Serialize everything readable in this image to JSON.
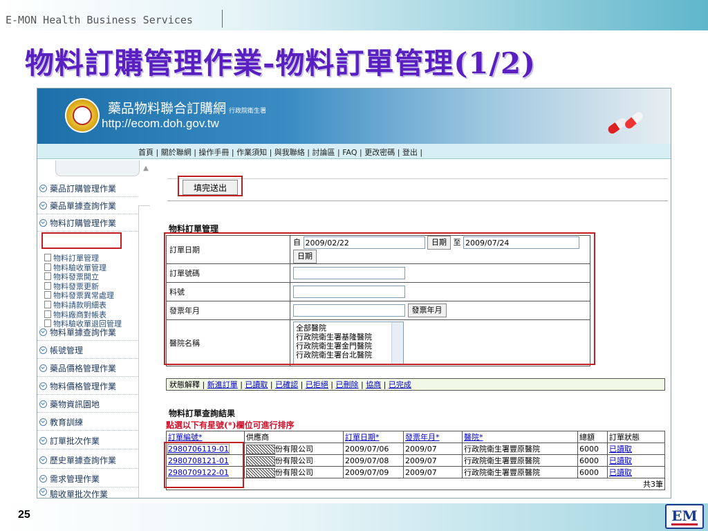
{
  "brand": "E-MON Health Business Services",
  "slide_title": "物料訂購管理作業-物料訂單管理(1/2)",
  "page_number": "25",
  "logo_text": "EM",
  "site": {
    "name": "藥品物料聯合訂購網",
    "org": "行政院衛生署",
    "url": "http://ecom.doh.gov.tw"
  },
  "nav": "首頁 | 關於聯網 | 操作手冊 | 作業須知 | 與我聯絡 | 討論區 | FAQ | 更改密碼 | 登出 |",
  "sidebar": {
    "items": [
      "藥品訂購管理作業",
      "藥品單據查詢作業",
      "物料訂購管理作業",
      "物料單據查詢作業",
      "帳號管理",
      "藥品價格管理作業",
      "物料價格管理作業",
      "藥物資訊園地",
      "教育訓練",
      "訂單批次作業",
      "歷史單據查詢作業",
      "需求管理作業",
      "驗收單批次作業"
    ],
    "subitems": [
      "物料訂單管理",
      "物料驗收單管理",
      "物料發票開立",
      "物料發票更新",
      "物料發票異常處理",
      "物料請款明細表",
      "物料廠商對帳表",
      "物料驗收單退回管理"
    ]
  },
  "main": {
    "submit_label": "填完送出",
    "form_title": "物料訂單管理",
    "form": {
      "order_date_label": "訂單日期",
      "from_prefix": "自",
      "date_from": "2009/02/22",
      "date_button": "日期",
      "to_prefix": "至",
      "date_to": "2009/07/24",
      "order_no_label": "訂單號碼",
      "item_no_label": "料號",
      "invoice_month_label": "發票年月",
      "invoice_month_button": "發票年月",
      "hospital_label": "醫院名稱",
      "hospital_options": [
        "全部醫院",
        "行政院衛生署基隆醫院",
        "行政院衛生署金門醫院",
        "行政院衛生署台北醫院"
      ]
    },
    "status_bar": {
      "label": "狀態解釋 |",
      "links": [
        "新進訂單",
        "已讀取",
        "已確認",
        "已拒絕",
        "已刪除",
        "協商",
        "已完成"
      ]
    },
    "results_title": "物料訂單查詢結果",
    "hint": "點選以下有星號(*)欄位可進行排序",
    "table": {
      "headers": [
        "訂單編號*",
        "供應商",
        "訂單日期*",
        "發票年月*",
        "醫院*",
        "總額",
        "訂單狀態"
      ],
      "rows": [
        [
          "2980706119-01",
          "份有限公司",
          "2009/07/06",
          "2009/07",
          "行政院衛生署豐原醫院",
          "6000",
          "已讀取"
        ],
        [
          "2980708121-01",
          "份有限公司",
          "2009/07/08",
          "2009/07",
          "行政院衛生署豐原醫院",
          "6000",
          "已讀取"
        ],
        [
          "2980709122-01",
          "份有限公司",
          "2009/07/09",
          "2009/07",
          "行政院衛生署豐原醫院",
          "6000",
          "已讀取"
        ]
      ],
      "total": "共3筆"
    }
  },
  "colors": {
    "title": "#5a1fc0",
    "highlight_box": "#c41e1e",
    "link": "#0000cc",
    "hint": "#d0122a"
  }
}
